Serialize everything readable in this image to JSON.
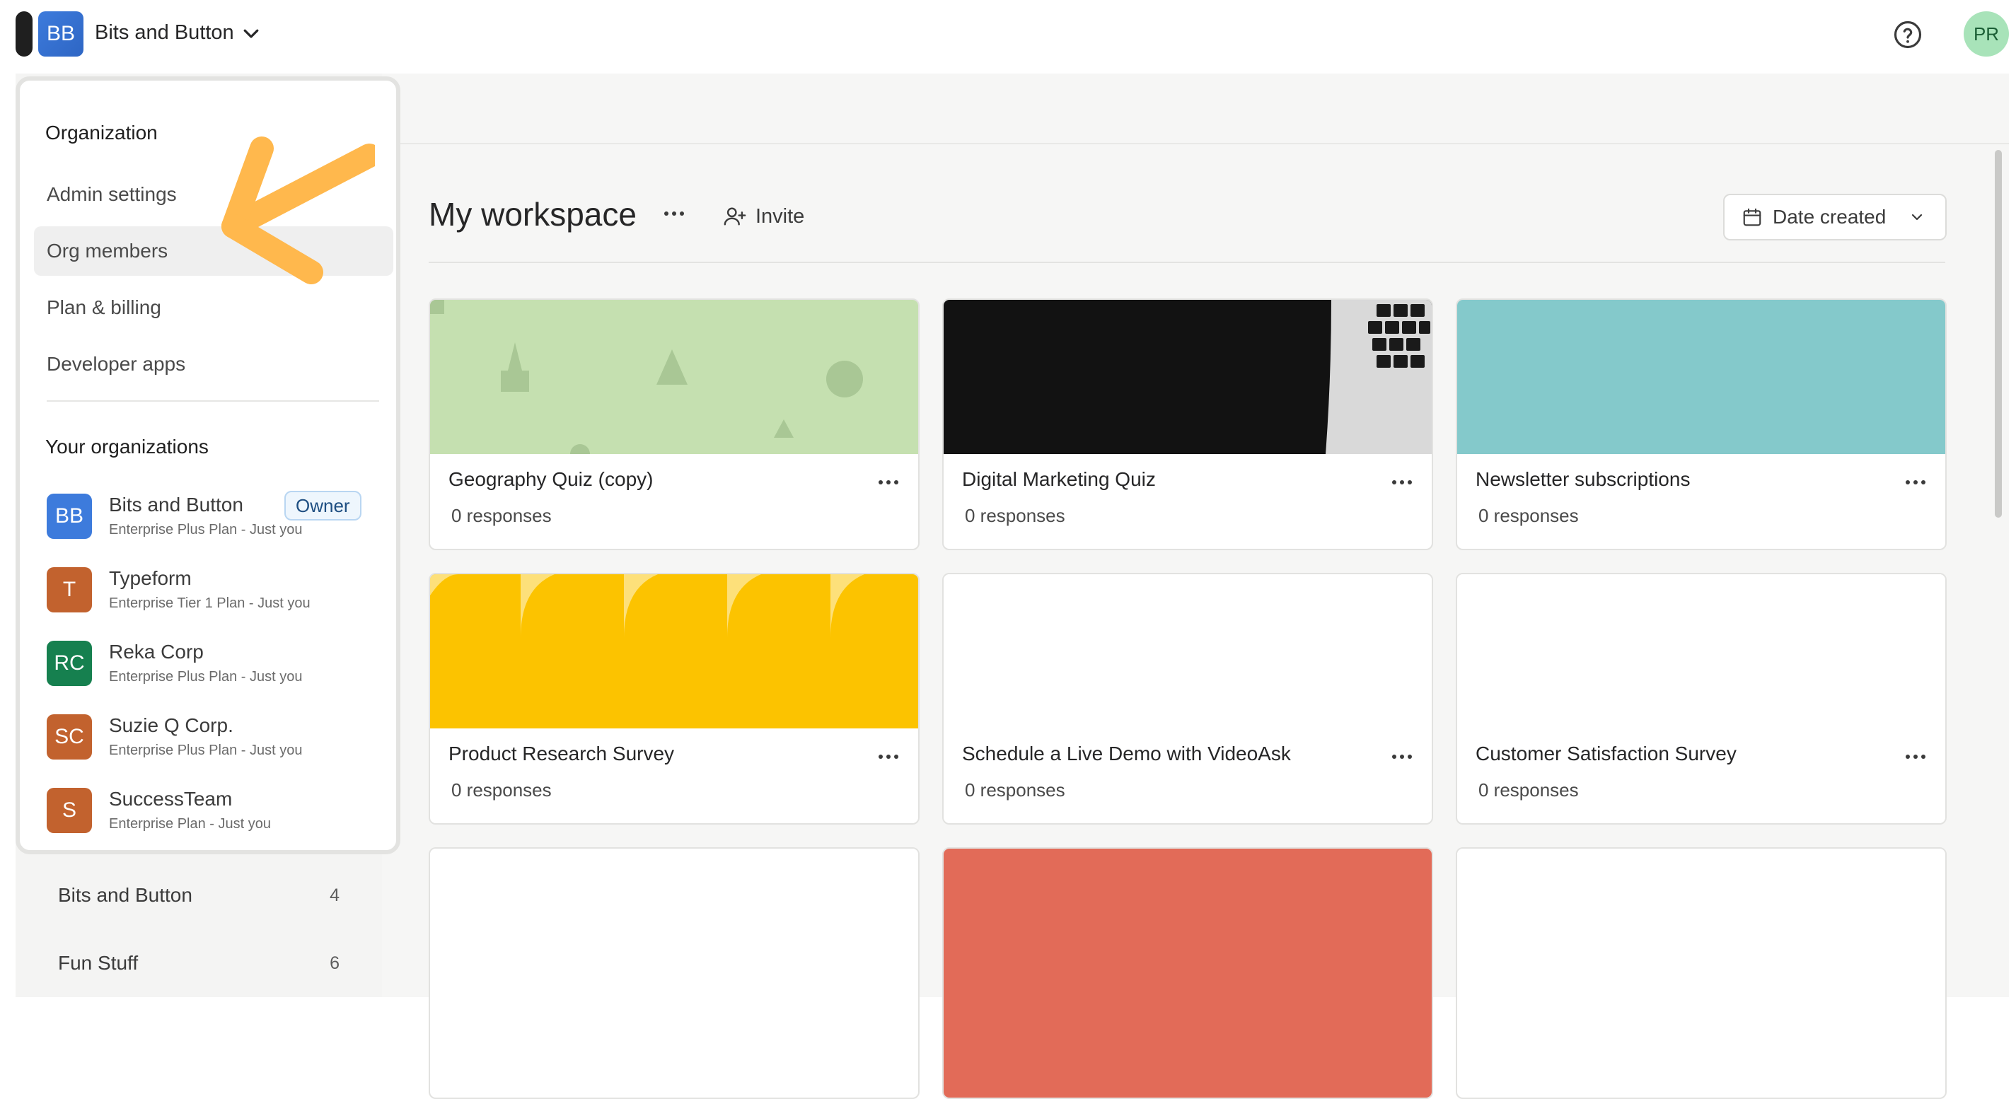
{
  "header": {
    "org_initials": "BB",
    "org_name": "Bits and Button",
    "user_initials": "PR"
  },
  "dropdown": {
    "organization_heading": "Organization",
    "menu_items": [
      {
        "label": "Admin settings"
      },
      {
        "label": "Org members",
        "active": true
      },
      {
        "label": "Plan & billing"
      },
      {
        "label": "Developer apps"
      }
    ],
    "your_orgs_heading": "Your organizations",
    "orgs": [
      {
        "initials": "BB",
        "name": "Bits and Button",
        "plan": "Enterprise Plus Plan - Just you",
        "badge": "Owner",
        "color": "#3d7bdc"
      },
      {
        "initials": "T",
        "name": "Typeform",
        "plan": "Enterprise Tier 1 Plan - Just you",
        "color": "#c2622e"
      },
      {
        "initials": "RC",
        "name": "Reka Corp",
        "plan": "Enterprise Plus Plan - Just you",
        "color": "#16804f"
      },
      {
        "initials": "SC",
        "name": "Suzie Q Corp.",
        "plan": "Enterprise Plus Plan - Just you",
        "color": "#c2622e"
      },
      {
        "initials": "S",
        "name": "SuccessTeam",
        "plan": "Enterprise Plan - Just you",
        "color": "#c2622e"
      }
    ]
  },
  "sidebar": {
    "workspaces": [
      {
        "name": "Bits and Button",
        "count": "4"
      },
      {
        "name": "Fun Stuff",
        "count": "6"
      }
    ]
  },
  "main": {
    "title": "My workspace",
    "invite_label": "Invite",
    "sort_label": "Date created"
  },
  "forms": [
    {
      "title": "Geography Quiz (copy)",
      "responses": "0 responses",
      "thumb_color": "#c5e0b0"
    },
    {
      "title": "Digital Marketing Quiz",
      "responses": "0 responses",
      "thumb_color": "#121212"
    },
    {
      "title": "Newsletter subscriptions",
      "responses": "0 responses",
      "thumb_color": "#84c9cb"
    },
    {
      "title": "Product Research Survey",
      "responses": "0 responses",
      "thumb_color": "#fcc300"
    },
    {
      "title": "Schedule a Live Demo with VideoAsk",
      "responses": "0 responses",
      "thumb_color": "#ffffff"
    },
    {
      "title": "Customer Satisfaction Survey",
      "responses": "0 responses",
      "thumb_color": "#ffffff"
    },
    {
      "title": "",
      "responses": "",
      "thumb_color": "#ffffff"
    },
    {
      "title": "",
      "responses": "",
      "thumb_color": "#e26b58"
    },
    {
      "title": "",
      "responses": "",
      "thumb_color": "#ffffff"
    }
  ],
  "colors": {
    "accent_arrow": "#ffb84d",
    "active_item_bg": "#efefef"
  }
}
